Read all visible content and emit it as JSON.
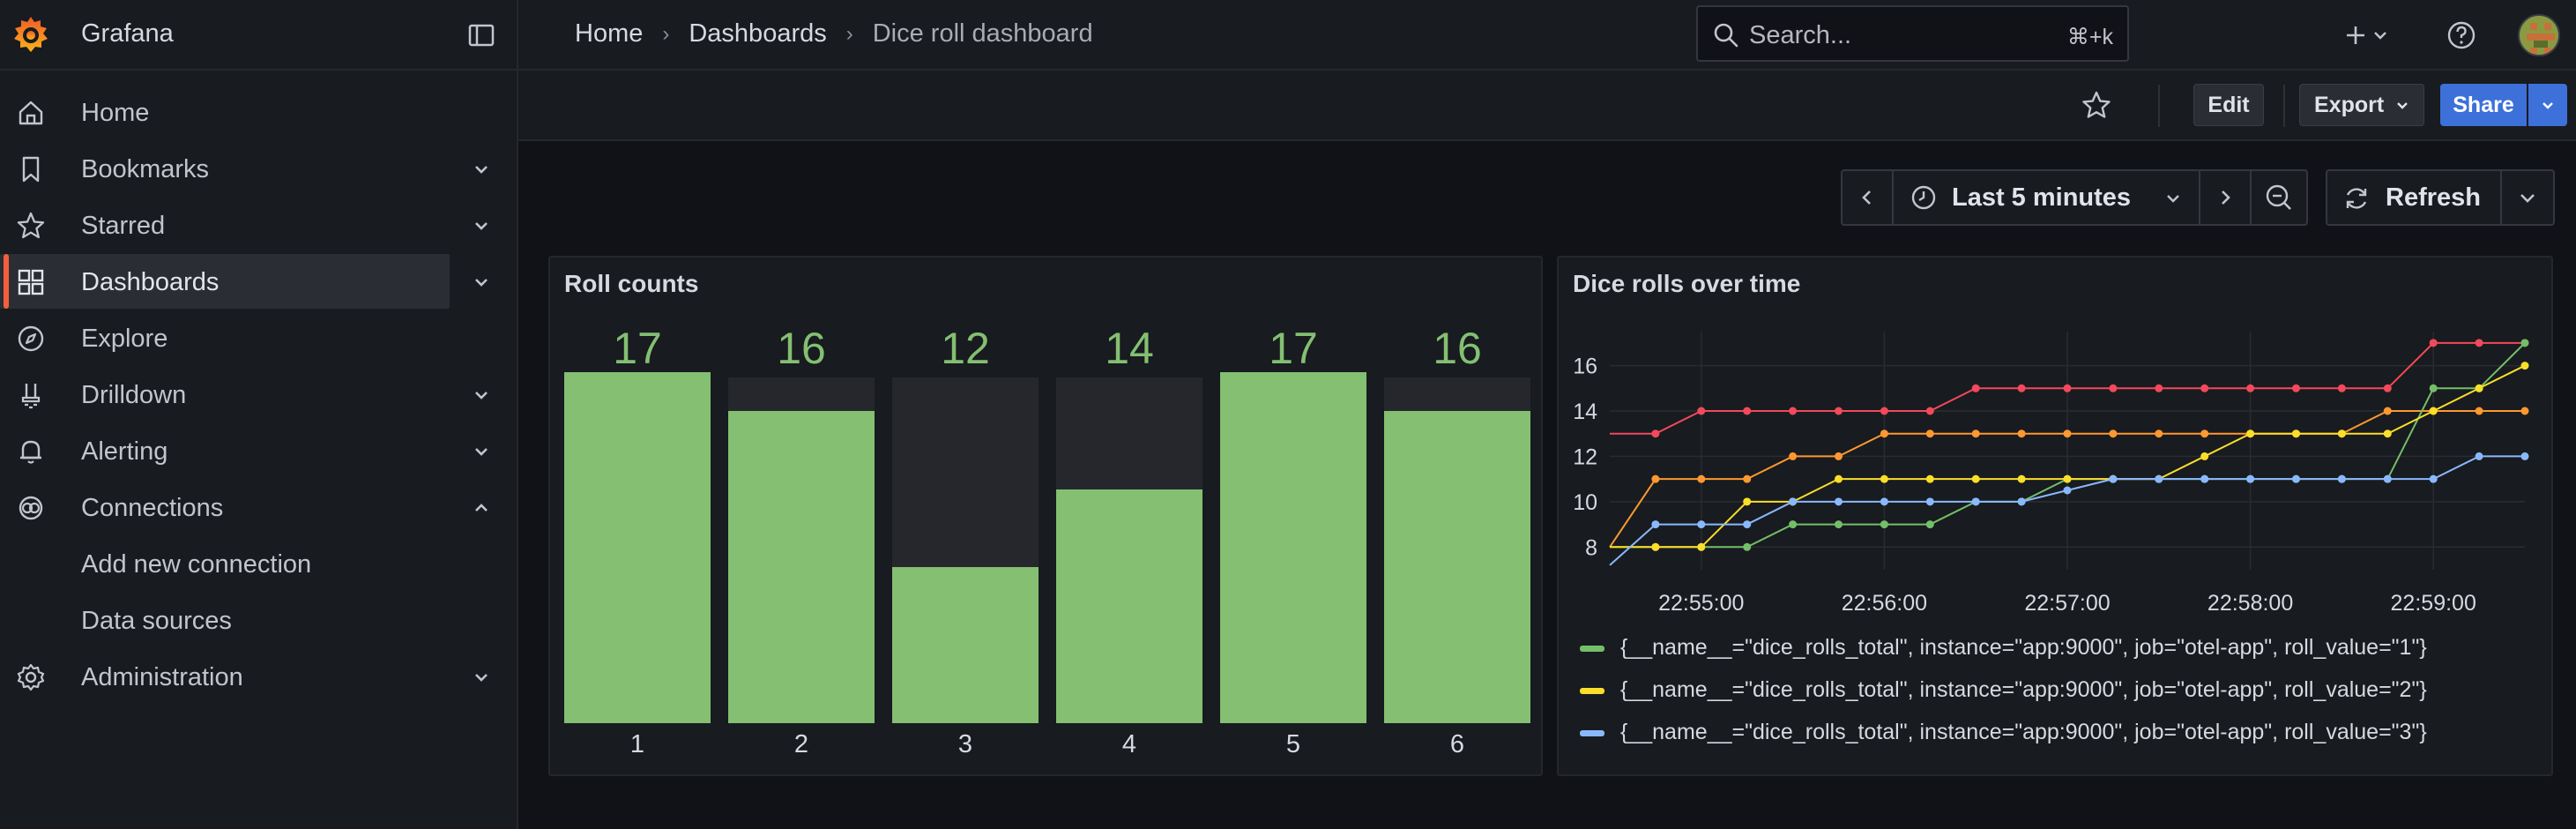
{
  "app": {
    "name": "Grafana"
  },
  "breadcrumb": {
    "home": "Home",
    "dashboards": "Dashboards",
    "current": "Dice roll dashboard"
  },
  "search": {
    "placeholder": "Search...",
    "shortcut": "⌘+k"
  },
  "sidebar": {
    "items": [
      {
        "label": "Home",
        "icon": "home-icon"
      },
      {
        "label": "Bookmarks",
        "icon": "bookmark-icon",
        "chevron": "down"
      },
      {
        "label": "Starred",
        "icon": "star-icon",
        "chevron": "down"
      },
      {
        "label": "Dashboards",
        "icon": "apps-icon",
        "chevron": "down",
        "active": true
      },
      {
        "label": "Explore",
        "icon": "compass-icon"
      },
      {
        "label": "Drilldown",
        "icon": "drilldown-icon",
        "chevron": "down"
      },
      {
        "label": "Alerting",
        "icon": "bell-icon",
        "chevron": "down"
      },
      {
        "label": "Connections",
        "icon": "connections-icon",
        "chevron": "up"
      },
      {
        "label": "Add new connection",
        "sub": true
      },
      {
        "label": "Data sources",
        "sub": true
      },
      {
        "label": "Administration",
        "icon": "cog-icon",
        "chevron": "down"
      }
    ]
  },
  "toolbar": {
    "edit": "Edit",
    "export": "Export",
    "share": "Share"
  },
  "timepicker": {
    "range": "Last 5 minutes",
    "refresh": "Refresh"
  },
  "colors": {
    "accent": "#f55f3e",
    "primary": "#3d71d9",
    "green": "#84bf72",
    "yellow": "#f2cc0c",
    "blue": "#8ab8ff",
    "orange": "#ff9830",
    "red": "#f2495c"
  },
  "panels": {
    "roll_counts": {
      "title": "Roll counts"
    },
    "dice_rolls": {
      "title": "Dice rolls over time"
    }
  },
  "chart_data": [
    {
      "type": "bar",
      "title": "Roll counts",
      "categories": [
        "1",
        "2",
        "3",
        "4",
        "5",
        "6"
      ],
      "values": [
        17,
        16,
        12,
        14,
        17,
        16
      ],
      "ylim": [
        8,
        17
      ]
    },
    {
      "type": "line",
      "title": "Dice rolls over time",
      "x": [
        "22:54:30",
        "22:54:45",
        "22:55:00",
        "22:55:15",
        "22:55:30",
        "22:55:45",
        "22:56:00",
        "22:56:15",
        "22:56:30",
        "22:56:45",
        "22:57:00",
        "22:57:15",
        "22:57:30",
        "22:57:45",
        "22:58:00",
        "22:58:15",
        "22:58:30",
        "22:58:45",
        "22:59:00",
        "22:59:15"
      ],
      "x_ticks": [
        "22:55:00",
        "22:56:00",
        "22:57:00",
        "22:58:00",
        "22:59:00"
      ],
      "y_ticks": [
        "8",
        "10",
        "12",
        "14",
        "16"
      ],
      "ylim": [
        7,
        17.5
      ],
      "series": [
        {
          "name": "{__name__=\"dice_rolls_total\", instance=\"app:9000\", job=\"otel-app\", roll_value=\"1\"}",
          "color": "#73bf69",
          "values": [
            8,
            8,
            8,
            8,
            9,
            9,
            9,
            9,
            10,
            10,
            11,
            11,
            11,
            11,
            11,
            11,
            11,
            11,
            15,
            15,
            17
          ]
        },
        {
          "name": "{__name__=\"dice_rolls_total\", instance=\"app:9000\", job=\"otel-app\", roll_value=\"2\"}",
          "color": "#fade2a",
          "values": [
            8,
            8,
            8,
            10,
            10,
            11,
            11,
            11,
            11,
            11,
            11,
            11,
            11,
            12,
            13,
            13,
            13,
            13,
            14,
            15,
            16
          ]
        },
        {
          "name": "{__name__=\"dice_rolls_total\", instance=\"app:9000\", job=\"otel-app\", roll_value=\"3\"}",
          "color": "#8ab8ff",
          "values": [
            7.2,
            9,
            9,
            9,
            10,
            10,
            10,
            10,
            10,
            10,
            10.5,
            11,
            11,
            11,
            11,
            11,
            11,
            11,
            11,
            12,
            12
          ]
        }
      ]
    }
  ]
}
